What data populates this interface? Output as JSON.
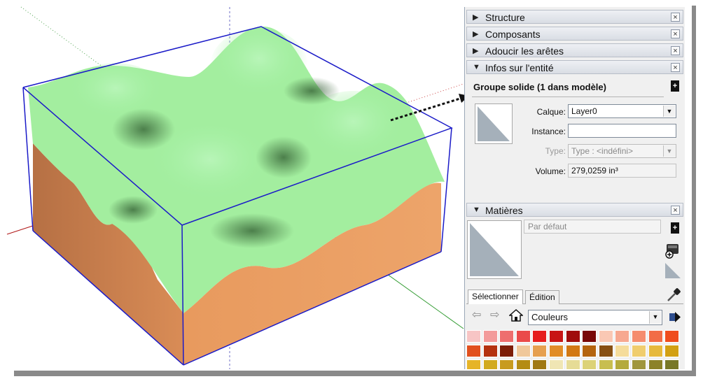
{
  "panels": {
    "structure": {
      "arrow": "▶",
      "label": "Structure",
      "close": "×"
    },
    "components": {
      "arrow": "▶",
      "label": "Composants",
      "close": "×"
    },
    "soften": {
      "arrow": "▶",
      "label": "Adoucir les arêtes",
      "close": "×"
    },
    "entity": {
      "arrow": "▼",
      "label": "Infos sur l'entité",
      "close": "×"
    },
    "materials": {
      "arrow": "▼",
      "label": "Matières",
      "close": "×"
    }
  },
  "entity_info": {
    "title": "Groupe solide (1 dans modèle)",
    "layer_label": "Calque:",
    "layer_value": "Layer0",
    "instance_label": "Instance:",
    "instance_value": "",
    "type_label": "Type:",
    "type_value": "Type : <indéfini>",
    "volume_label": "Volume:",
    "volume_value": "279,0259 in³"
  },
  "materials": {
    "name_placeholder": "Par défaut",
    "tabs": [
      "Sélectionner",
      "Édition"
    ],
    "collection": "Couleurs",
    "swatch_rows": [
      [
        "#f7c5c5",
        "#f39a9a",
        "#ee6e6e",
        "#ea4a4a",
        "#e61e1e",
        "#c81414",
        "#a00c0c",
        "#780808",
        "#fac8b4",
        "#f7a890",
        "#f58c6e",
        "#f26c46",
        "#ef4d1e"
      ],
      [
        "#e1501e",
        "#b4320f",
        "#7d1e08",
        "#f0c89b",
        "#e6a050",
        "#e18c28",
        "#d27814",
        "#b4640f",
        "#875014",
        "#f5dc9b",
        "#f0cd6e",
        "#e6b93c",
        "#d2a014"
      ],
      [
        "#e6b428",
        "#d2aa1e",
        "#c89b1e",
        "#b48c14",
        "#a07814",
        "#f0e6b4",
        "#e6dc96",
        "#dcd278",
        "#c8be50",
        "#b4aa3c",
        "#a0963c",
        "#8c8228",
        "#787828"
      ]
    ]
  },
  "icons": {
    "add_detail": "add-detail-icon",
    "create_material": "create-material-icon",
    "eyedropper": "eyedropper-icon",
    "home": "home-icon",
    "back": "back-arrow-icon",
    "forward": "forward-arrow-icon",
    "details": "details-arrow-icon"
  }
}
